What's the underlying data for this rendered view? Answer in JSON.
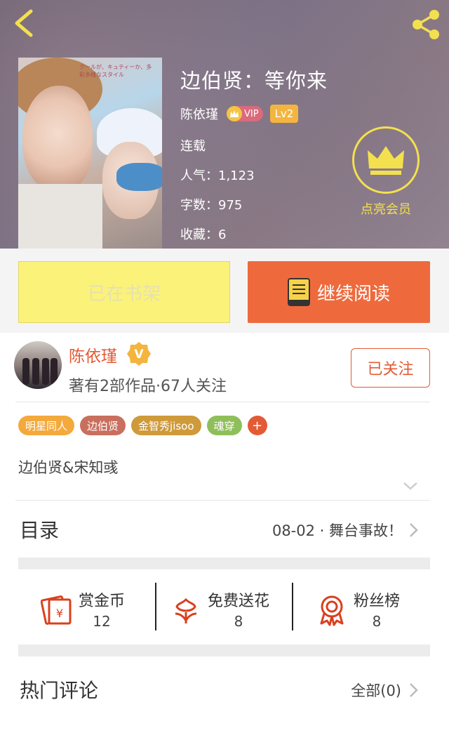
{
  "book": {
    "title": "边伯贤：等你来",
    "author": "陈依瑾",
    "vip_label": "VIP",
    "level": "Lv2",
    "status": "连载",
    "popularity": "人气：1,123",
    "words": "字数：975",
    "favorites": "收藏：6",
    "member_label": "点亮会员",
    "cover_text": "クールが、キュティーか、多彩多様なスタイル"
  },
  "actions": {
    "shelf_label": "已在书架",
    "read_label": "继续阅读"
  },
  "author_card": {
    "name": "陈依瑾",
    "stats": "著有2部作品·67人关注",
    "follow_label": "已关注"
  },
  "tags": [
    {
      "label": "明星同人",
      "color": "#f4a93c"
    },
    {
      "label": "边伯贤",
      "color": "#c96f5e"
    },
    {
      "label": "金智秀jisoo",
      "color": "#cf9a3a"
    },
    {
      "label": "魂穿",
      "color": "#8fbf5a"
    }
  ],
  "tag_add": "+",
  "description": "边伯贤&宋知彧",
  "toc": {
    "title": "目录",
    "latest": "08-02 · 舞台事故！"
  },
  "stats": [
    {
      "label": "赏金币",
      "value": "12",
      "icon": "red-envelope-icon"
    },
    {
      "label": "免费送花",
      "value": "8",
      "icon": "flower-icon"
    },
    {
      "label": "粉丝榜",
      "value": "8",
      "icon": "medal-icon"
    }
  ],
  "comments": {
    "title": "热门评论",
    "all_label": "全部(0)"
  },
  "colors": {
    "accent": "#e45a35",
    "shelf_bg": "#fbf27a",
    "read_bg": "#ee6a3d",
    "member_gold": "#f3e04e"
  }
}
